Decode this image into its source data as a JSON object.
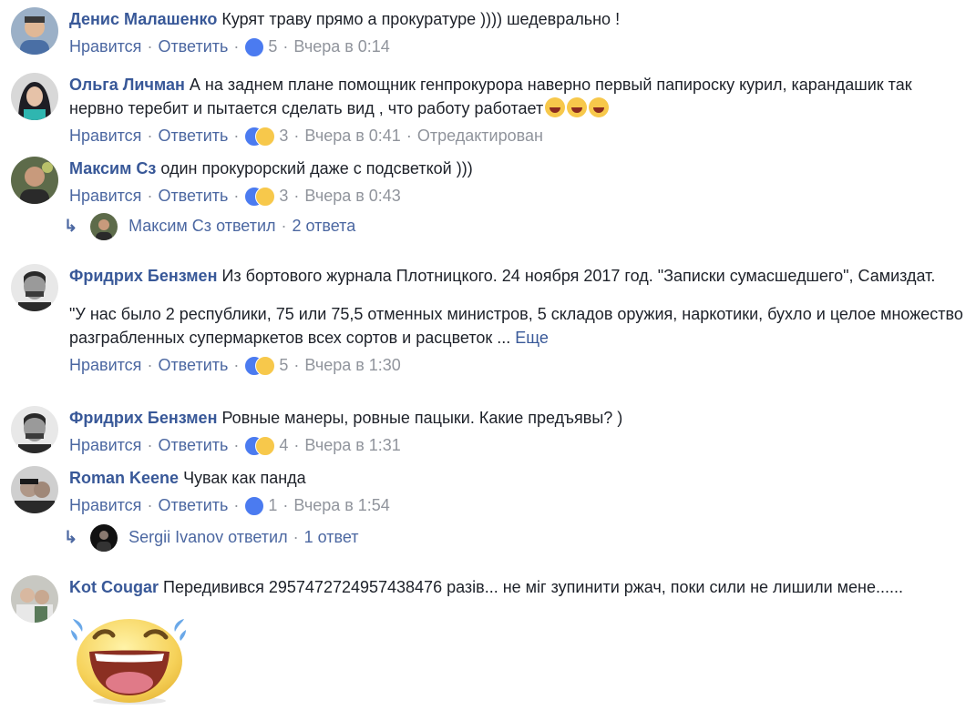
{
  "ui": {
    "like": "Нравится",
    "reply": "Ответить",
    "dot": "·",
    "more": "Еще"
  },
  "comments": [
    {
      "author": "Денис Малашенко",
      "text": "Курят траву прямо а прокуратуре )))) шедеврально !",
      "count": "5",
      "time": "Вчера в 0:14",
      "edited": ""
    },
    {
      "author": "Ольга Личман",
      "text": "А на заднем плане помощник генпрокурора наверно первый папироску курил, карандашик так нервно теребит и пытается сделать вид , что работу работает",
      "count": "3",
      "time": "Вчера в 0:41",
      "edited": "Отредактирован"
    },
    {
      "author": "Максим Сз",
      "text": "один прокурорский даже с подсветкой )))",
      "count": "3",
      "time": "Вчера в 0:43",
      "edited": ""
    },
    {
      "author": "Фридрих Бензмен",
      "text": "Из бортового журнала Плотницкого. 24 ноября 2017 год. \"Записки сумасшедшего\", Самиздат.",
      "text2": "\"У нас было 2 республики, 75 или 75,5 отменных министров, 5 складов оружия, наркотики, бухло и целое множество разграбленных супермаркетов всех сортов и расцветок ...",
      "count": "5",
      "time": "Вчера в 1:30",
      "edited": ""
    },
    {
      "author": "Фридрих Бензмен",
      "text": "Ровные манеры, ровные пацыки. Какие предъявы? )",
      "count": "4",
      "time": "Вчера в 1:31",
      "edited": ""
    },
    {
      "author": "Roman Keene",
      "text": "Чувак как панда",
      "count": "1",
      "time": "Вчера в 1:54",
      "edited": ""
    },
    {
      "author": "Kot Cougar",
      "text": "Передивився 2957472724957438476 разів... не міг зупинити ржач, поки сили не лишили мене......"
    }
  ],
  "replies": [
    {
      "author": "Максим Сз",
      "verb": "ответил",
      "count": "2 ответа"
    },
    {
      "author": "Sergii Ivanov",
      "verb": "ответил",
      "count": "1 ответ"
    }
  ]
}
